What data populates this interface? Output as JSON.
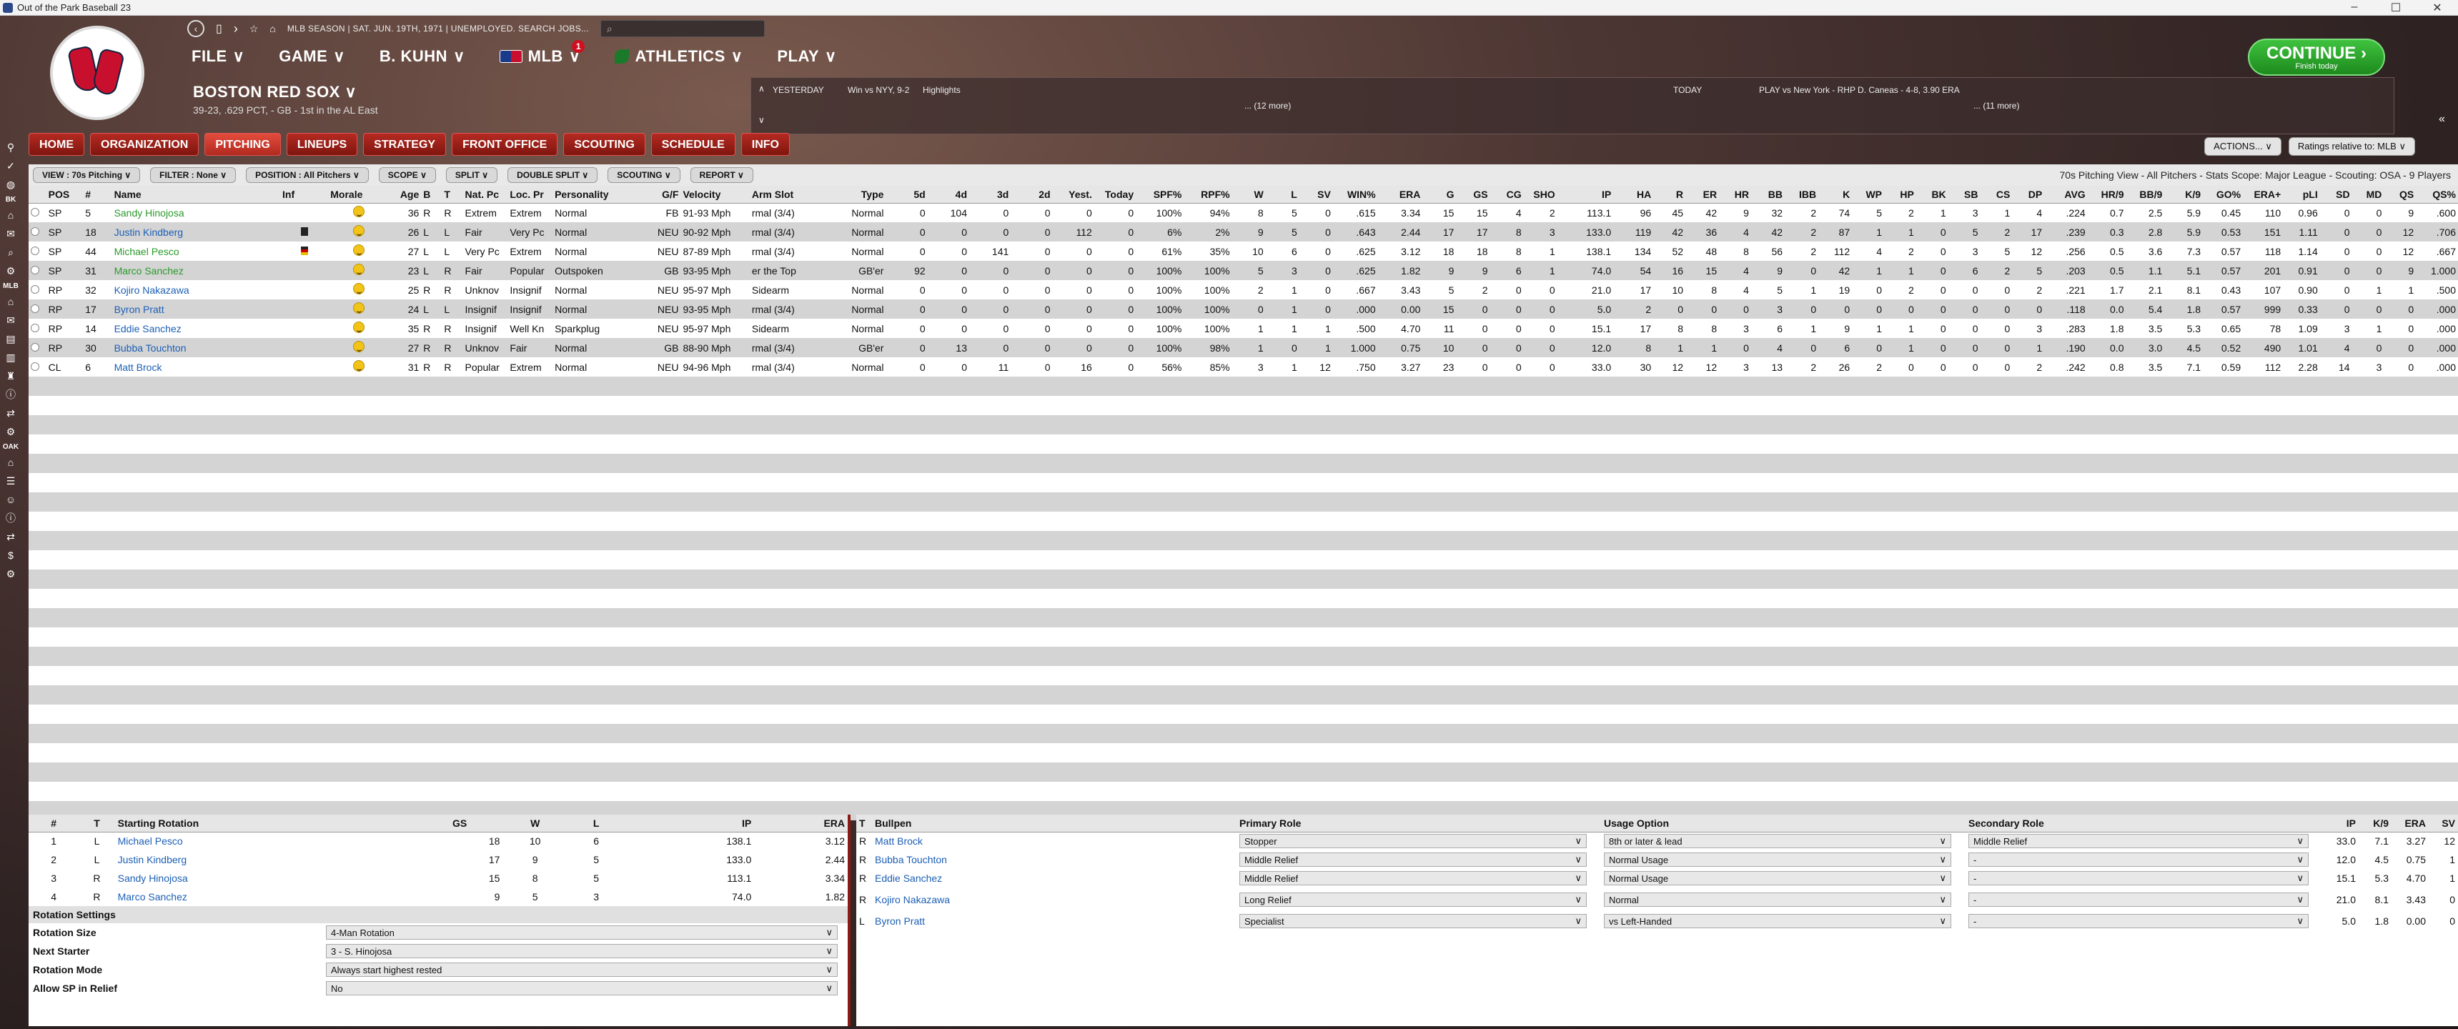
{
  "window": {
    "title": "Out of the Park Baseball 23"
  },
  "topnav": {
    "date": "MLB SEASON | SAT. JUN. 19TH, 1971 | UNEMPLOYED. SEARCH JOBS...",
    "search_placeholder": ""
  },
  "menu": [
    "FILE",
    "GAME",
    "B. KUHN",
    "MLB",
    "ATHLETICS",
    "PLAY"
  ],
  "menu_badge": "1",
  "team": {
    "name": "BOSTON RED SOX",
    "record": "39-23, .629 PCT, - GB - 1st in the AL East"
  },
  "scores": {
    "yesterday_label": "YESTERDAY",
    "yesterday_game": "Win vs NYY, 9-2",
    "highlights": "Highlights",
    "more_left": "... (12 more)",
    "today_label": "TODAY",
    "today_game": "PLAY vs New York - RHP D. Caneas - 4-8, 3.90 ERA",
    "more_right": "... (11 more)"
  },
  "continue": {
    "label": "CONTINUE",
    "sub": "Finish today"
  },
  "sidebar_labels": [
    "BK",
    "MLB",
    "OAK"
  ],
  "tabs": [
    "HOME",
    "ORGANIZATION",
    "PITCHING",
    "LINEUPS",
    "STRATEGY",
    "FRONT OFFICE",
    "SCOUTING",
    "SCHEDULE",
    "INFO"
  ],
  "actions": {
    "actions": "ACTIONS...",
    "ratings": "Ratings relative to: MLB"
  },
  "filters": [
    "VIEW : 70s Pitching",
    "FILTER : None",
    "POSITION : All Pitchers",
    "SCOPE",
    "SPLIT",
    "DOUBLE SPLIT",
    "SCOUTING",
    "REPORT"
  ],
  "view_info": "70s Pitching View - All Pitchers - Stats Scope: Major League - Scouting: OSA - 9 Players",
  "columns": [
    "",
    "POS",
    "#",
    "Name",
    "Inf",
    "Morale",
    "Age",
    "B",
    "T",
    "Nat. Pc",
    "Loc. Pr",
    "Personality",
    "G/F",
    "Velocity",
    "Arm Slot",
    "Type",
    "5d",
    "4d",
    "3d",
    "2d",
    "Yest.",
    "Today",
    "SPF%",
    "RPF%",
    "W",
    "L",
    "SV",
    "WIN%",
    "ERA",
    "G",
    "GS",
    "CG",
    "SHO",
    "IP",
    "HA",
    "R",
    "ER",
    "HR",
    "BB",
    "IBB",
    "K",
    "WP",
    "HP",
    "BK",
    "SB",
    "CS",
    "DP",
    "AVG",
    "HR/9",
    "BB/9",
    "K/9",
    "GO%",
    "ERA+",
    "pLI",
    "SD",
    "MD",
    "QS",
    "QS%"
  ],
  "players": [
    [
      "",
      "SP",
      "5",
      "Sandy Hinojosa",
      "",
      "",
      "36",
      "R",
      "R",
      "Extrem",
      "Extrem",
      "Normal",
      "FB",
      "91-93 Mph",
      "rmal (3/4)",
      "Normal",
      "0",
      "104",
      "0",
      "0",
      "0",
      "0",
      "100%",
      "94%",
      "8",
      "5",
      "0",
      ".615",
      "3.34",
      "15",
      "15",
      "4",
      "2",
      "113.1",
      "96",
      "45",
      "42",
      "9",
      "32",
      "2",
      "74",
      "5",
      "2",
      "1",
      "3",
      "1",
      "4",
      ".224",
      "0.7",
      "2.5",
      "5.9",
      "0.45",
      "110",
      "0.96",
      "0",
      "0",
      "9",
      ".600"
    ],
    [
      "",
      "SP",
      "18",
      "Justin Kindberg",
      "",
      "",
      "26",
      "L",
      "L",
      "Fair",
      "Very Pc",
      "Normal",
      "NEU",
      "90-92 Mph",
      "rmal (3/4)",
      "Normal",
      "0",
      "0",
      "0",
      "0",
      "112",
      "0",
      "6%",
      "2%",
      "9",
      "5",
      "0",
      ".643",
      "2.44",
      "17",
      "17",
      "8",
      "3",
      "133.0",
      "119",
      "42",
      "36",
      "4",
      "42",
      "2",
      "87",
      "1",
      "1",
      "0",
      "5",
      "2",
      "17",
      ".239",
      "0.3",
      "2.8",
      "5.9",
      "0.53",
      "151",
      "1.11",
      "0",
      "0",
      "12",
      ".706"
    ],
    [
      "",
      "SP",
      "44",
      "Michael Pesco",
      "",
      "",
      "27",
      "L",
      "L",
      "Very Pc",
      "Extrem",
      "Normal",
      "NEU",
      "87-89 Mph",
      "rmal (3/4)",
      "Normal",
      "0",
      "0",
      "141",
      "0",
      "0",
      "0",
      "61%",
      "35%",
      "10",
      "6",
      "0",
      ".625",
      "3.12",
      "18",
      "18",
      "8",
      "1",
      "138.1",
      "134",
      "52",
      "48",
      "8",
      "56",
      "2",
      "112",
      "4",
      "2",
      "0",
      "3",
      "5",
      "12",
      ".256",
      "0.5",
      "3.6",
      "7.3",
      "0.57",
      "118",
      "1.14",
      "0",
      "0",
      "12",
      ".667"
    ],
    [
      "",
      "SP",
      "31",
      "Marco Sanchez",
      "",
      "",
      "23",
      "L",
      "R",
      "Fair",
      "Popular",
      "Outspoken",
      "GB",
      "93-95 Mph",
      "er the Top",
      "GB'er",
      "92",
      "0",
      "0",
      "0",
      "0",
      "0",
      "100%",
      "100%",
      "5",
      "3",
      "0",
      ".625",
      "1.82",
      "9",
      "9",
      "6",
      "1",
      "74.0",
      "54",
      "16",
      "15",
      "4",
      "9",
      "0",
      "42",
      "1",
      "1",
      "0",
      "6",
      "2",
      "5",
      ".203",
      "0.5",
      "1.1",
      "5.1",
      "0.57",
      "201",
      "0.91",
      "0",
      "0",
      "9",
      "1.000"
    ],
    [
      "",
      "RP",
      "32",
      "Kojiro Nakazawa",
      "",
      "",
      "25",
      "R",
      "R",
      "Unknov",
      "Insignif",
      "Normal",
      "NEU",
      "95-97 Mph",
      "Sidearm",
      "Normal",
      "0",
      "0",
      "0",
      "0",
      "0",
      "0",
      "100%",
      "100%",
      "2",
      "1",
      "0",
      ".667",
      "3.43",
      "5",
      "2",
      "0",
      "0",
      "21.0",
      "17",
      "10",
      "8",
      "4",
      "5",
      "1",
      "19",
      "0",
      "2",
      "0",
      "0",
      "0",
      "2",
      ".221",
      "1.7",
      "2.1",
      "8.1",
      "0.43",
      "107",
      "0.90",
      "0",
      "1",
      "1",
      ".500"
    ],
    [
      "",
      "RP",
      "17",
      "Byron Pratt",
      "",
      "",
      "24",
      "L",
      "L",
      "Insignif",
      "Insignif",
      "Normal",
      "NEU",
      "93-95 Mph",
      "rmal (3/4)",
      "Normal",
      "0",
      "0",
      "0",
      "0",
      "0",
      "0",
      "100%",
      "100%",
      "0",
      "1",
      "0",
      ".000",
      "0.00",
      "15",
      "0",
      "0",
      "0",
      "5.0",
      "2",
      "0",
      "0",
      "0",
      "3",
      "0",
      "0",
      "0",
      "0",
      "0",
      "0",
      "0",
      "0",
      ".118",
      "0.0",
      "5.4",
      "1.8",
      "0.57",
      "999",
      "0.33",
      "0",
      "0",
      "0",
      ".000"
    ],
    [
      "",
      "RP",
      "14",
      "Eddie Sanchez",
      "",
      "",
      "35",
      "R",
      "R",
      "Insignif",
      "Well Kn",
      "Sparkplug",
      "NEU",
      "95-97 Mph",
      "Sidearm",
      "Normal",
      "0",
      "0",
      "0",
      "0",
      "0",
      "0",
      "100%",
      "100%",
      "1",
      "1",
      "1",
      ".500",
      "4.70",
      "11",
      "0",
      "0",
      "0",
      "15.1",
      "17",
      "8",
      "8",
      "3",
      "6",
      "1",
      "9",
      "1",
      "1",
      "0",
      "0",
      "0",
      "3",
      ".283",
      "1.8",
      "3.5",
      "5.3",
      "0.65",
      "78",
      "1.09",
      "3",
      "1",
      "0",
      ".000"
    ],
    [
      "",
      "RP",
      "30",
      "Bubba Touchton",
      "",
      "",
      "27",
      "R",
      "R",
      "Unknov",
      "Fair",
      "Normal",
      "GB",
      "88-90 Mph",
      "rmal (3/4)",
      "GB'er",
      "0",
      "13",
      "0",
      "0",
      "0",
      "0",
      "100%",
      "98%",
      "1",
      "0",
      "1",
      "1.000",
      "0.75",
      "10",
      "0",
      "0",
      "0",
      "12.0",
      "8",
      "1",
      "1",
      "0",
      "4",
      "0",
      "6",
      "0",
      "1",
      "0",
      "0",
      "0",
      "1",
      ".190",
      "0.0",
      "3.0",
      "4.5",
      "0.52",
      "490",
      "1.01",
      "4",
      "0",
      "0",
      ".000"
    ],
    [
      "",
      "CL",
      "6",
      "Matt Brock",
      "",
      "",
      "31",
      "R",
      "R",
      "Popular",
      "Extrem",
      "Normal",
      "NEU",
      "94-96 Mph",
      "rmal (3/4)",
      "Normal",
      "0",
      "0",
      "11",
      "0",
      "16",
      "0",
      "56%",
      "85%",
      "3",
      "1",
      "12",
      ".750",
      "3.27",
      "23",
      "0",
      "0",
      "0",
      "33.0",
      "30",
      "12",
      "12",
      "3",
      "13",
      "2",
      "26",
      "2",
      "0",
      "0",
      "0",
      "0",
      "2",
      ".242",
      "0.8",
      "3.5",
      "7.1",
      "0.59",
      "112",
      "2.28",
      "14",
      "3",
      "0",
      ".000"
    ]
  ],
  "rotation": {
    "headers": [
      "#",
      "T",
      "Starting Rotation",
      "GS",
      "W",
      "L",
      "IP",
      "ERA"
    ],
    "rows": [
      [
        "1",
        "L",
        "Michael Pesco",
        "18",
        "10",
        "6",
        "138.1",
        "3.12"
      ],
      [
        "2",
        "L",
        "Justin Kindberg",
        "17",
        "9",
        "5",
        "133.0",
        "2.44"
      ],
      [
        "3",
        "R",
        "Sandy Hinojosa",
        "15",
        "8",
        "5",
        "113.1",
        "3.34"
      ],
      [
        "4",
        "R",
        "Marco Sanchez",
        "9",
        "5",
        "3",
        "74.0",
        "1.82"
      ]
    ]
  },
  "rotation_settings": {
    "title": "Rotation Settings",
    "rows": [
      [
        "Rotation Size",
        "4-Man Rotation"
      ],
      [
        "Next Starter",
        "3 - S. Hinojosa"
      ],
      [
        "Rotation Mode",
        "Always start highest rested"
      ],
      [
        "Allow SP in Relief",
        "No"
      ]
    ]
  },
  "bullpen": {
    "headers": [
      "T",
      "Bullpen",
      "Primary Role",
      "Usage Option",
      "Secondary Role",
      "IP",
      "K/9",
      "ERA",
      "SV"
    ],
    "rows": [
      [
        "R",
        "Matt Brock",
        "Stopper",
        "8th or later & lead",
        "Middle Relief",
        "33.0",
        "7.1",
        "3.27",
        "12"
      ],
      [
        "R",
        "Bubba Touchton",
        "Middle Relief",
        "Normal Usage",
        "-",
        "12.0",
        "4.5",
        "0.75",
        "1"
      ],
      [
        "R",
        "Eddie Sanchez",
        "Middle Relief",
        "Normal Usage",
        "-",
        "15.1",
        "5.3",
        "4.70",
        "1"
      ],
      [
        "R",
        "Kojiro Nakazawa",
        "Long Relief",
        "Normal",
        "-",
        "21.0",
        "8.1",
        "3.43",
        "0"
      ],
      [
        "L",
        "Byron Pratt",
        "Specialist",
        "vs Left-Handed",
        "-",
        "5.0",
        "1.8",
        "0.00",
        "0"
      ]
    ]
  }
}
